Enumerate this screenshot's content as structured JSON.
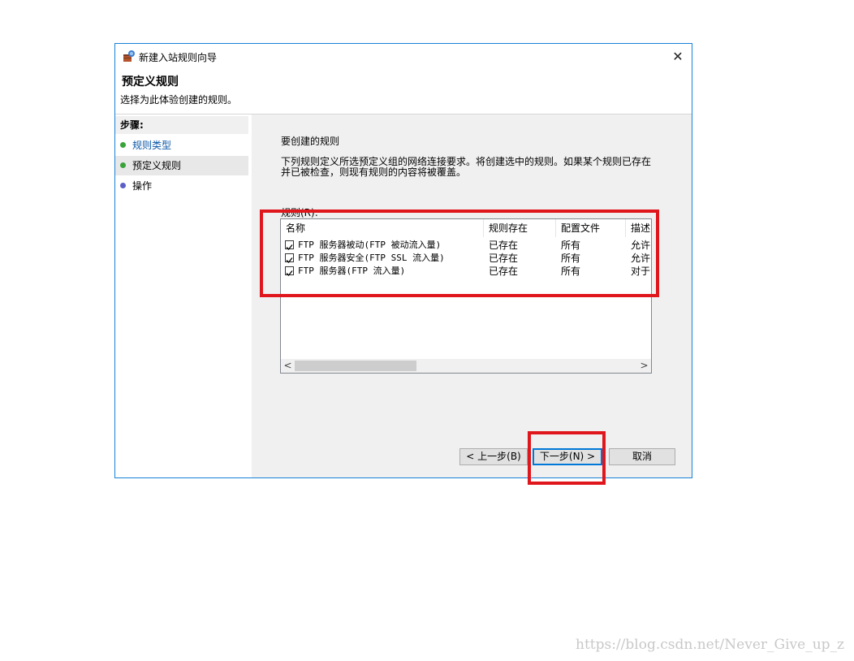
{
  "window": {
    "title": "新建入站规则向导",
    "close_glyph": "✕"
  },
  "header": {
    "title": "预定义规则",
    "subtitle": "选择为此体验创建的规则。"
  },
  "steps": {
    "title": "步骤:",
    "items": [
      {
        "label": "规则类型",
        "dot_color": "#3aa33a"
      },
      {
        "label": "预定义规则",
        "dot_color": "#3aa33a"
      },
      {
        "label": "操作",
        "dot_color": "#5b5fc7"
      }
    ]
  },
  "content": {
    "section_title": "要创建的规则",
    "description": "下列规则定义所选预定义组的网络连接要求。将创建选中的规则。如果某个规则已存在并已被检查，则现有规则的内容将被覆盖。",
    "rules_label": "规则(R):",
    "columns": [
      "名称",
      "规则存在",
      "配置文件",
      "描述"
    ],
    "rows": [
      {
        "name": "FTP 服务器被动(FTP 被动流入量)",
        "exists": "已存在",
        "profile": "所有",
        "desc": "允许",
        "checked": true
      },
      {
        "name": "FTP 服务器安全(FTP SSL 流入量)",
        "exists": "已存在",
        "profile": "所有",
        "desc": "允许",
        "checked": true
      },
      {
        "name": "FTP 服务器(FTP 流入量)",
        "exists": "已存在",
        "profile": "所有",
        "desc": "对于",
        "checked": true
      }
    ],
    "scroll_left": "<",
    "scroll_right": ">"
  },
  "buttons": {
    "back": "< 上一步(B)",
    "next": "下一步(N) >",
    "cancel": "取消"
  },
  "watermark": "https://blog.csdn.net/Never_Give_up_z",
  "colors": {
    "accent_border": "#1883d7",
    "highlight_red": "#e0161d",
    "link_blue": "#0c57a7"
  }
}
